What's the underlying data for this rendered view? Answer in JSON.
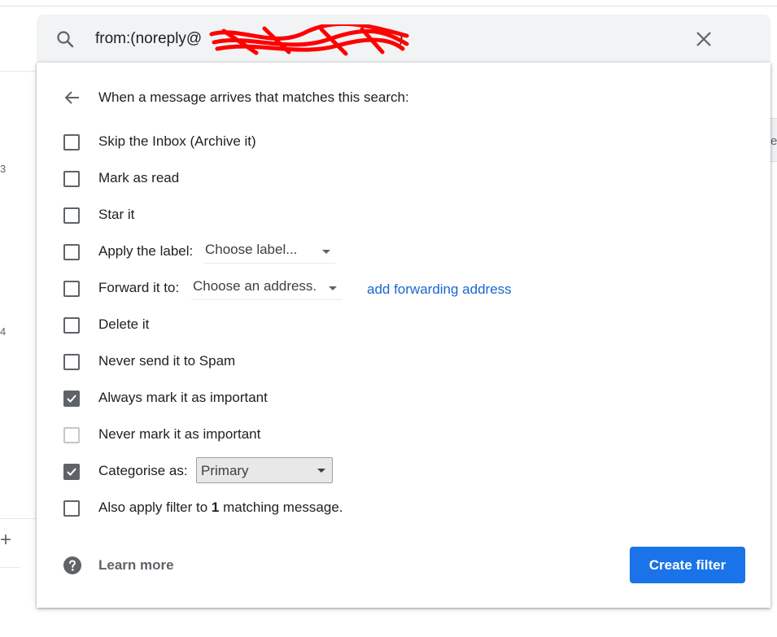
{
  "background": {
    "left_numbers": [
      "3",
      "4"
    ],
    "plus": "+",
    "right_fragment": "e"
  },
  "search": {
    "query_prefix": "from:(noreply@",
    "query_suffix": ")"
  },
  "panel": {
    "header": "When a message arrives that matches this search:",
    "options": [
      {
        "label": "Skip the Inbox (Archive it)",
        "checked": false
      },
      {
        "label": "Mark as read",
        "checked": false
      },
      {
        "label": "Star it",
        "checked": false
      },
      {
        "label": "Apply the label:",
        "checked": false
      },
      {
        "label": "Forward it to:",
        "checked": false
      },
      {
        "label": "Delete it",
        "checked": false
      },
      {
        "label": "Never send it to Spam",
        "checked": false
      },
      {
        "label": "Always mark it as important",
        "checked": true
      },
      {
        "label": "Never mark it as important",
        "checked": false,
        "disabled": true
      },
      {
        "label": "Categorise as:",
        "checked": true
      },
      {
        "label_pre": "Also apply filter to ",
        "label_count": "1",
        "label_post": " matching message.",
        "checked": false
      }
    ],
    "label_dropdown": "Choose label...",
    "forward_dropdown": "Choose an address.",
    "forward_link": "add forwarding address",
    "category_value": "Primary",
    "learn_more": "Learn more",
    "create_button": "Create filter"
  },
  "colors": {
    "primary_button": "#1a73e8",
    "link": "#1967d2",
    "checkbox": "#5f6368",
    "search_bg": "#f1f3f4"
  }
}
